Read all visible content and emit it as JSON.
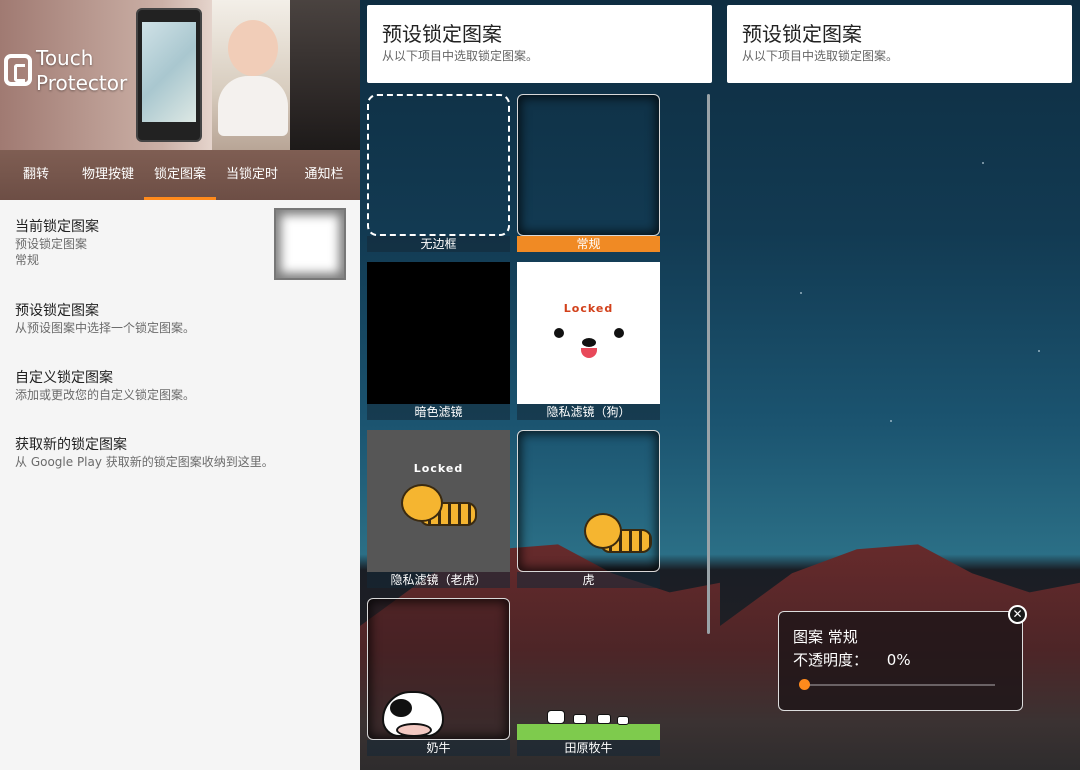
{
  "panel1": {
    "brand_line1": "Touch",
    "brand_line2": "Protector",
    "tabs": [
      {
        "label": "翻转"
      },
      {
        "label": "物理按键"
      },
      {
        "label": "锁定图案"
      },
      {
        "label": "当锁定时"
      },
      {
        "label": "通知栏"
      }
    ],
    "active_tab": "锁定图案",
    "prefs": [
      {
        "title": "当前锁定图案",
        "sub1": "预设锁定图案",
        "sub2": "常规"
      },
      {
        "title": "预设锁定图案",
        "sub1": "从预设图案中选择一个锁定图案。"
      },
      {
        "title": "自定义锁定图案",
        "sub1": "添加或更改您的自定义锁定图案。"
      },
      {
        "title": "获取新的锁定图案",
        "sub1": "从 Google Play 获取新的锁定图案收纳到这里。"
      }
    ]
  },
  "panel2": {
    "header_title": "预设锁定图案",
    "header_sub": "从以下项目中选取锁定图案。",
    "tiles": [
      {
        "label": "无边框",
        "selected": false
      },
      {
        "label": "常规",
        "selected": true
      },
      {
        "label": "暗色滤镜",
        "selected": false
      },
      {
        "label": "隐私滤镜（狗）",
        "selected": false,
        "art_text": "Locked"
      },
      {
        "label": "隐私滤镜（老虎）",
        "selected": false,
        "art_text": "Locked"
      },
      {
        "label": "虎",
        "selected": false
      },
      {
        "label": "奶牛",
        "selected": false
      },
      {
        "label": "田原牧牛",
        "selected": false
      }
    ],
    "accent_color": "#f08a24"
  },
  "panel3": {
    "header_title": "预设锁定图案",
    "header_sub": "从以下项目中选取锁定图案。",
    "dialog": {
      "pattern_line": "图案 常规",
      "opacity_label": "不透明度：",
      "opacity_value": "0%",
      "opacity_fraction": 0,
      "close_icon": "close-circle-icon"
    }
  }
}
